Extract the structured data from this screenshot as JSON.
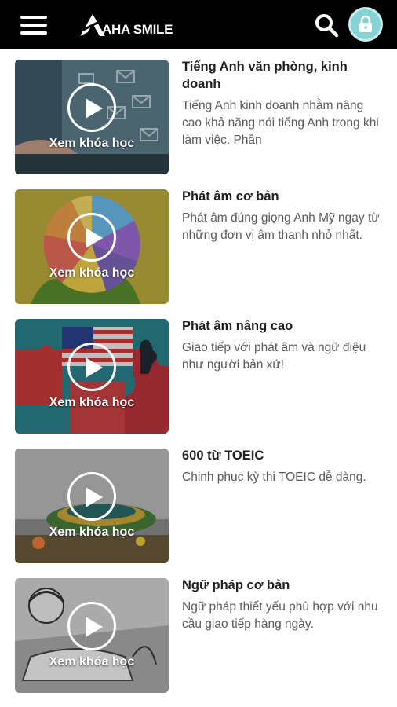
{
  "header": {
    "brand": "AHA SMILE",
    "colors": {
      "bar": "#000000",
      "lock": "#86d3d6"
    }
  },
  "courses": [
    {
      "title": "Tiếng Anh văn phòng, kinh doanh",
      "description": "Tiếng Anh kinh doanh nhằm nâng cao khả năng nói tiếng Anh trong khi làm việc. Phần",
      "button": "Xem khóa học"
    },
    {
      "title": "Phát âm cơ bản",
      "description": "Phát âm đúng giọng Anh Mỹ ngay từ những đơn vị âm thanh nhỏ nhất.",
      "button": "Xem khóa học"
    },
    {
      "title": "Phát âm nâng cao",
      "description": "Giao tiếp với phát âm và ngữ điệu như người bản xứ!",
      "button": "Xem khóa học"
    },
    {
      "title": "600 từ TOEIC",
      "description": "Chinh phục kỳ thi TOEIC dễ dàng.",
      "button": "Xem khóa học"
    },
    {
      "title": "Ngữ pháp cơ bản",
      "description": "Ngữ pháp thiết yếu phù hợp với nhu cầu giao tiếp hàng ngày.",
      "button": "Xem khóa học"
    }
  ]
}
